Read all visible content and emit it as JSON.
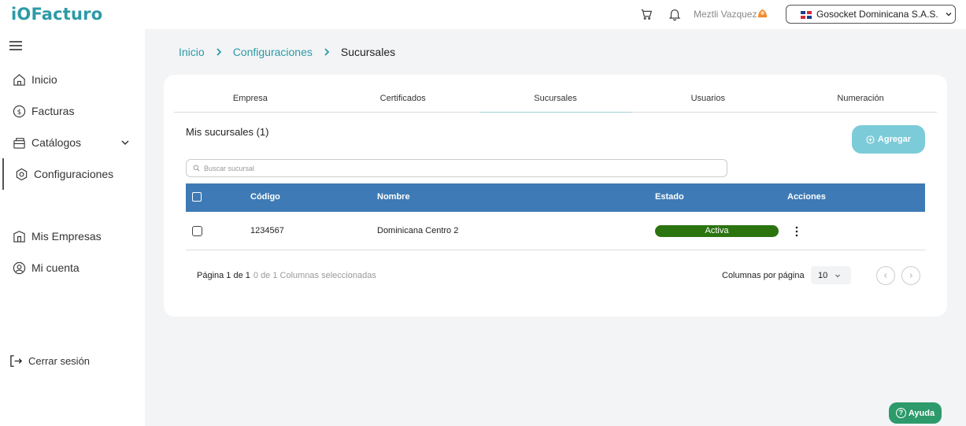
{
  "app": {
    "logo_prefix": "iO",
    "logo_text": "Facturo"
  },
  "header": {
    "cart_icon": "cart-icon",
    "bell_icon": "bell-icon",
    "user_name": "Meztli Vazquez",
    "company": "Gosocket Dominicana S.A.S."
  },
  "sidebar": {
    "items": [
      {
        "label": "Inicio",
        "icon": "home-icon"
      },
      {
        "label": "Facturas",
        "icon": "dollar-circle-icon"
      },
      {
        "label": "Catálogos",
        "icon": "catalog-icon"
      },
      {
        "label": "Configuraciones",
        "icon": "settings-icon"
      },
      {
        "label": "Mis Empresas",
        "icon": "building-icon"
      },
      {
        "label": "Mi cuenta",
        "icon": "account-icon"
      }
    ],
    "logout": "Cerrar sesión"
  },
  "breadcrumb": [
    "Inicio",
    "Configuraciones",
    "Sucursales"
  ],
  "tabs": [
    "Empresa",
    "Certificados",
    "Sucursales",
    "Usuarios",
    "Numeración"
  ],
  "active_tab": "Sucursales",
  "main": {
    "section_title": "Mis sucursales (1)",
    "add_label": "Agregar",
    "search_placeholder": "Buscar sucursal"
  },
  "table": {
    "columns": [
      "Código",
      "Nombre",
      "Estado",
      "Acciones"
    ],
    "rows": [
      {
        "codigo": "1234567",
        "nombre": "Dominicana Centro 2",
        "estado": "Activa"
      }
    ]
  },
  "footer": {
    "page_info": "Página 1 de 1",
    "selection_info": "0 de 1 Columnas seleccionadas",
    "page_size_label": "Columnas por página",
    "page_size": "10"
  },
  "help_label": "Ayuda",
  "colors": {
    "brand": "#2c9aa6",
    "table_header": "#3e7ab5",
    "status_active": "#2b7410",
    "add_button": "#7ccbd8",
    "help_button": "#2c9a6a"
  }
}
